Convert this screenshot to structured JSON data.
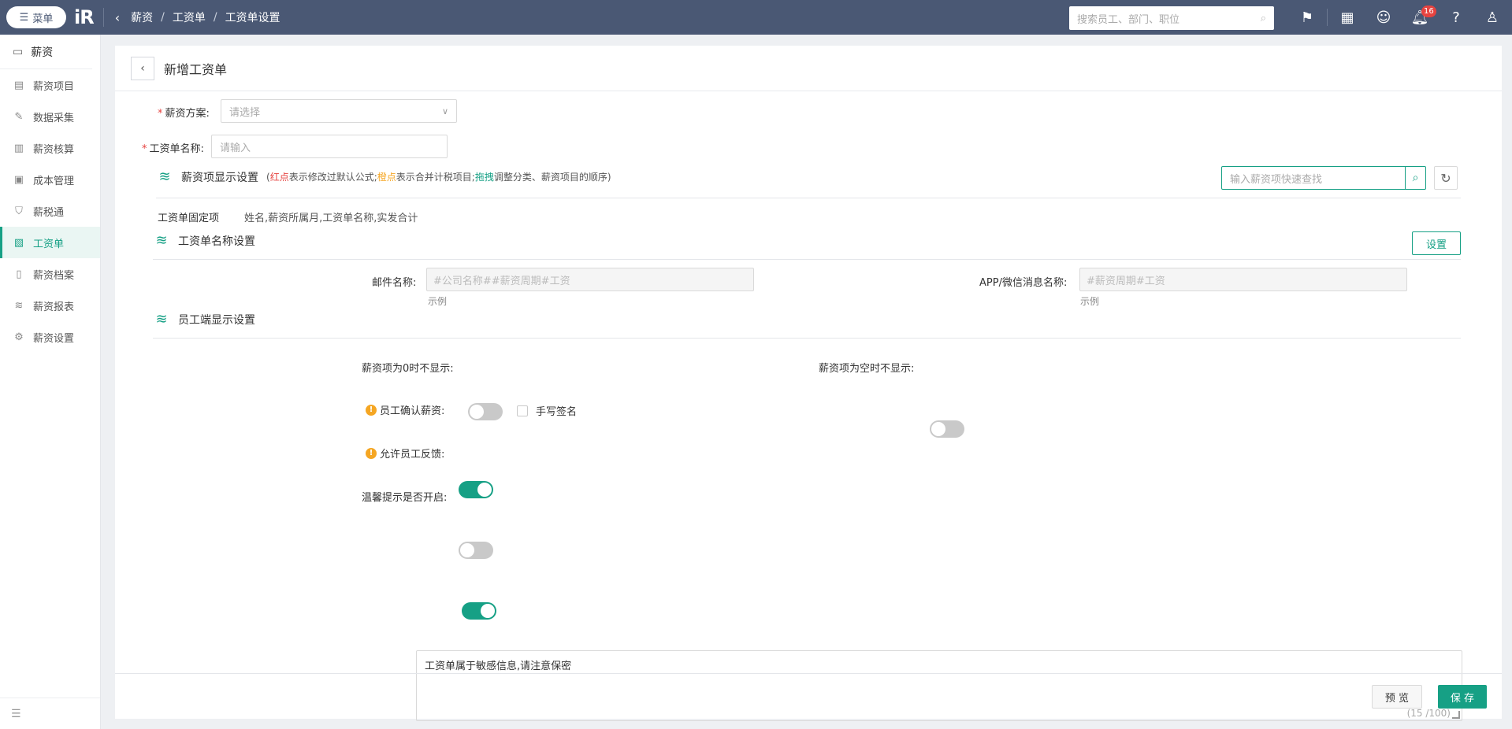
{
  "topbar": {
    "menu_label": "菜单",
    "logo": "iR",
    "breadcrumbs": [
      "薪资",
      "工资单",
      "工资单设置"
    ],
    "search_placeholder": "搜索员工、部门、职位",
    "notification_count": "16"
  },
  "sidebar": {
    "header": "薪资",
    "items": [
      {
        "label": "薪资项目",
        "icon": "payroll-item-icon"
      },
      {
        "label": "数据采集",
        "icon": "data-collect-icon"
      },
      {
        "label": "薪资核算",
        "icon": "calculate-icon"
      },
      {
        "label": "成本管理",
        "icon": "cost-icon"
      },
      {
        "label": "薪税通",
        "icon": "tax-icon"
      },
      {
        "label": "工资单",
        "icon": "payslip-icon",
        "active": true
      },
      {
        "label": "薪资档案",
        "icon": "archive-icon"
      },
      {
        "label": "薪资报表",
        "icon": "report-icon"
      },
      {
        "label": "薪资设置",
        "icon": "settings-icon"
      }
    ]
  },
  "page": {
    "title": "新增工资单"
  },
  "form": {
    "scheme_label": "薪资方案:",
    "scheme_placeholder": "请选择",
    "name_label": "工资单名称:",
    "name_placeholder": "请输入"
  },
  "display_settings": {
    "title": "薪资项显示设置",
    "hint_open": "(",
    "hint_red": "红点",
    "hint_part1": "表示修改过默认公式;",
    "hint_orange": "橙点",
    "hint_part2": "表示合并计税项目;",
    "hint_green": "拖拽",
    "hint_part3": "调整分类、薪资项目的顺序)",
    "search_placeholder": "输入薪资项快速查找",
    "fixed_label": "工资单固定项",
    "fixed_value": "姓名,薪资所属月,工资单名称,实发合计"
  },
  "name_settings": {
    "title": "工资单名称设置",
    "set_button": "设置",
    "mail_label": "邮件名称:",
    "mail_value": "#公司名称##薪资周期#工资",
    "mail_example": "示例",
    "app_label": "APP/微信消息名称:",
    "app_value": "#薪资周期#工资",
    "app_example": "示例"
  },
  "employee_settings": {
    "title": "员工端显示设置",
    "zero_hide_label": "薪资项为0时不显示:",
    "zero_hide_on": false,
    "empty_hide_label": "薪资项为空时不显示:",
    "empty_hide_on": false,
    "confirm_label": "员工确认薪资:",
    "confirm_on": true,
    "signature_label": "手写签名",
    "signature_checked": false,
    "feedback_label": "允许员工反馈:",
    "feedback_on": false,
    "tip_label": "温馨提示是否开启:",
    "tip_on": true,
    "tip_text": "工资单属于敏感信息,请注意保密",
    "tip_count": "(15 /100)"
  },
  "footer": {
    "preview_button": "预 览",
    "save_button": "保 存"
  },
  "colors": {
    "topbar": "#4a5874",
    "accent": "#16a085",
    "required": "#e64340",
    "warning": "#f5a623"
  }
}
